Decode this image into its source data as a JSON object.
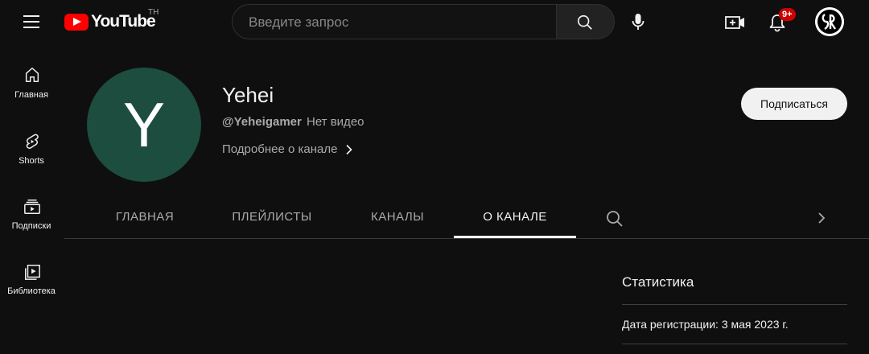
{
  "topbar": {
    "logo_text": "YouTube",
    "country_code": "TH",
    "search_placeholder": "Введите запрос",
    "notifications_badge": "9+"
  },
  "sidebar": {
    "items": [
      {
        "label": "Главная",
        "icon": "home-icon"
      },
      {
        "label": "Shorts",
        "icon": "shorts-icon"
      },
      {
        "label": "Подписки",
        "icon": "subscriptions-icon"
      },
      {
        "label": "Библиотека",
        "icon": "library-icon"
      }
    ]
  },
  "channel": {
    "avatar_letter": "Y",
    "avatar_color": "#1d4d3e",
    "name": "Yehei",
    "handle": "@Yeheigamer",
    "videos_text": "Нет видео",
    "more_link": "Подробнее о канале",
    "subscribe_label": "Подписаться"
  },
  "tabs": [
    {
      "label": "ГЛАВНАЯ",
      "active": false
    },
    {
      "label": "ПЛЕЙЛИСТЫ",
      "active": false
    },
    {
      "label": "КАНАЛЫ",
      "active": false
    },
    {
      "label": "О КАНАЛЕ",
      "active": true
    }
  ],
  "stats": {
    "title": "Статистика",
    "registration": "Дата регистрации: 3 мая 2023 г."
  }
}
